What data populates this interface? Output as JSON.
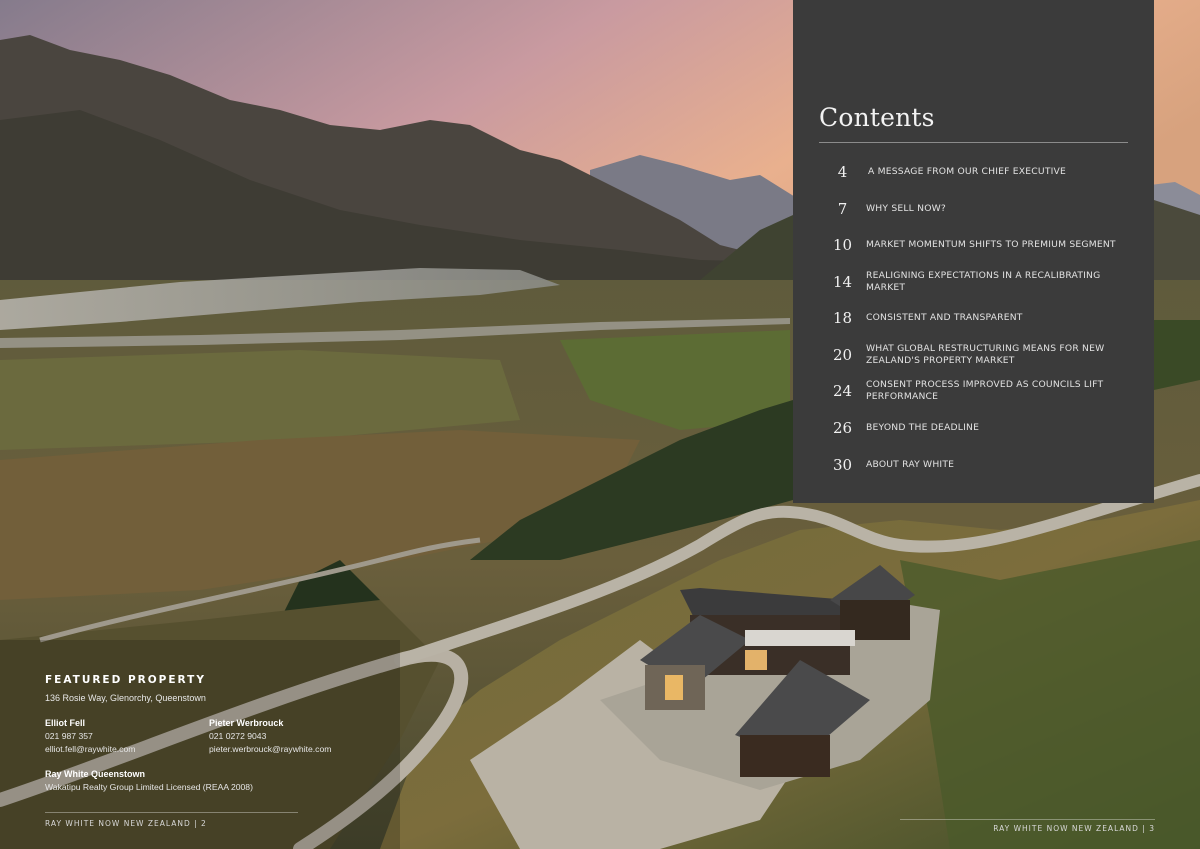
{
  "contents": {
    "title": "Contents",
    "items": [
      {
        "page": "4",
        "label": "A MESSAGE FROM OUR CHIEF EXECUTIVE"
      },
      {
        "page": "7",
        "label": "WHY SELL NOW?"
      },
      {
        "page": "10",
        "label": "MARKET MOMENTUM SHIFTS TO PREMIUM SEGMENT"
      },
      {
        "page": "14",
        "label": "REALIGNING EXPECTATIONS IN A RECALIBRATING MARKET"
      },
      {
        "page": "18",
        "label": "CONSISTENT AND TRANSPARENT"
      },
      {
        "page": "20",
        "label": "WHAT GLOBAL RESTRUCTURING MEANS FOR NEW ZEALAND'S PROPERTY MARKET"
      },
      {
        "page": "24",
        "label": "CONSENT PROCESS IMPROVED AS COUNCILS LIFT PERFORMANCE"
      },
      {
        "page": "26",
        "label": "BEYOND THE DEADLINE"
      },
      {
        "page": "30",
        "label": "ABOUT RAY WHITE"
      }
    ]
  },
  "featured": {
    "heading": "FEATURED PROPERTY",
    "address": "136 Rosie Way, Glenorchy, Queenstown",
    "agents": [
      {
        "name": "Elliot Fell",
        "phone": "021 987 357",
        "email": "elliot.fell@raywhite.com"
      },
      {
        "name": "Pieter Werbrouck",
        "phone": "021 0272 9043",
        "email": "pieter.werbrouck@raywhite.com"
      }
    ],
    "office": {
      "name": "Ray White Queenstown",
      "licence": "Wakatipu Realty Group Limited Licensed (REAA 2008)"
    }
  },
  "footer": {
    "left": "RAY WHITE NOW NEW ZEALAND | 2",
    "right": "RAY WHITE NOW NEW ZEALAND | 3"
  },
  "colors": {
    "panel": "#3b3b3b",
    "sky_top": "#8c7f8f",
    "sky_glow": "#e9b38f"
  }
}
